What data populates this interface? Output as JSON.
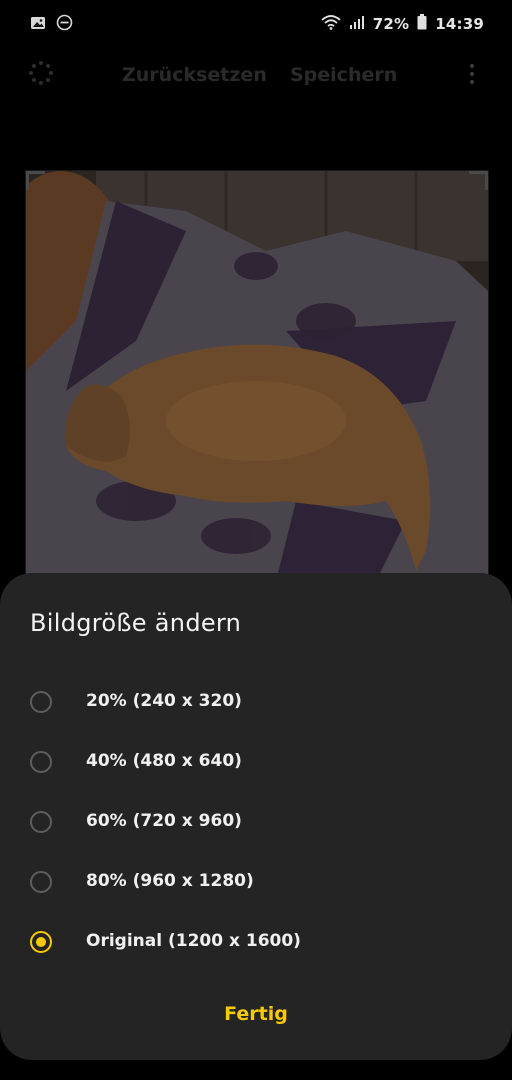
{
  "status_bar": {
    "battery": "72%",
    "time": "14:39",
    "icons": [
      "image-icon",
      "dnd-icon",
      "wifi-icon",
      "signal-icon",
      "battery-icon"
    ]
  },
  "toolbar": {
    "reset_label": "Zurücksetzen",
    "save_label": "Speichern"
  },
  "dialog": {
    "title": "Bildgröße ändern",
    "options": [
      {
        "label": "20% (240 x 320)",
        "selected": false
      },
      {
        "label": "40% (480 x 640)",
        "selected": false
      },
      {
        "label": "60% (720 x 960)",
        "selected": false
      },
      {
        "label": "80% (960 x 1280)",
        "selected": false
      },
      {
        "label": "Original (1200 x 1600)",
        "selected": true
      }
    ],
    "done_label": "Fertig"
  },
  "colors": {
    "accent": "#f7c900",
    "sheet": "#242424"
  }
}
